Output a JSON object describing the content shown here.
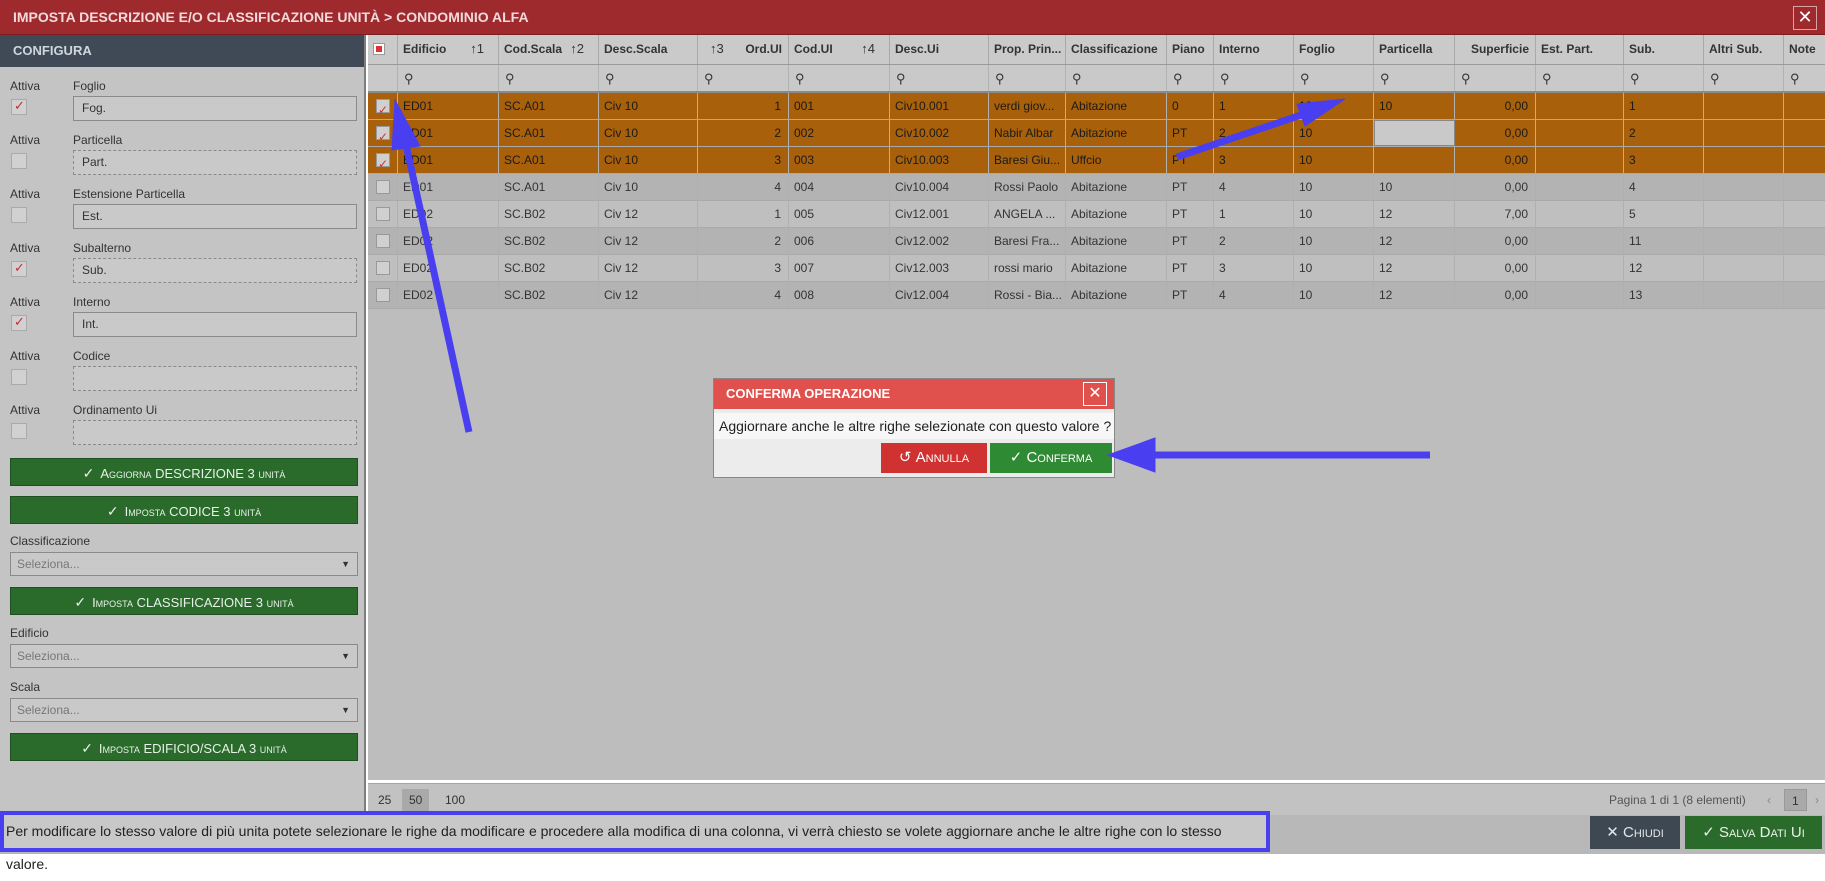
{
  "window": {
    "title": "IMPOSTA DESCRIZIONE E/O CLASSIFICAZIONE UNITÀ > CONDOMINIO ALFA",
    "close": "✕"
  },
  "config": {
    "header": "CONFIGURA",
    "active_label": "Attiva",
    "fields": [
      {
        "label": "Foglio",
        "value": "Fog.",
        "active": true
      },
      {
        "label": "Particella",
        "value": "Part.",
        "active": false
      },
      {
        "label": "Estensione Particella",
        "value": "Est.",
        "active": false
      },
      {
        "label": "Subalterno",
        "value": "Sub.",
        "active": true
      },
      {
        "label": "Interno",
        "value": "Int.",
        "active": true
      },
      {
        "label": "Codice",
        "value": "",
        "active": false
      },
      {
        "label": "Ordinamento Ui",
        "value": "",
        "active": false
      }
    ],
    "btn_descrizione": "Aggiorna DESCRIZIONE 3 unità",
    "btn_codice": "Imposta CODICE 3 unità",
    "classificazione_label": "Classificazione",
    "classificazione_placeholder": "Seleziona...",
    "btn_classificazione": "Imposta CLASSIFICAZIONE 3 unità",
    "edificio_label": "Edificio",
    "edificio_placeholder": "Seleziona...",
    "scala_label": "Scala",
    "scala_placeholder": "Seleziona...",
    "btn_edificio": "Imposta EDIFICIO/SCALA 3 unità"
  },
  "grid": {
    "columns": [
      "Edificio",
      "Cod.Scala",
      "Desc.Scala",
      "Ord.UI",
      "Cod.UI",
      "Desc.Ui",
      "Prop. Prin...",
      "Classificazione",
      "Piano",
      "Interno",
      "Foglio",
      "Particella",
      "Superficie",
      "Est. Part.",
      "Sub.",
      "Altri Sub.",
      "Note"
    ],
    "sort_marks": {
      "edificio": "↑1",
      "codscala": "↑2",
      "ordui": "↑3",
      "codui": "↑4"
    },
    "rows": [
      [
        "ED01",
        "SC.A01",
        "Civ 10",
        "1",
        "001",
        "Civ10.001",
        "verdi giov...",
        "Abitazione",
        "0",
        "1",
        "10",
        "10",
        "0,00",
        "",
        "1",
        "",
        ""
      ],
      [
        "ED01",
        "SC.A01",
        "Civ 10",
        "2",
        "002",
        "Civ10.002",
        "Nabir Albar",
        "Abitazione",
        "PT",
        "2",
        "10",
        "",
        "0,00",
        "",
        "2",
        "",
        ""
      ],
      [
        "ED01",
        "SC.A01",
        "Civ 10",
        "3",
        "003",
        "Civ10.003",
        "Baresi Giu...",
        "Uffcio",
        "PT",
        "3",
        "10",
        "",
        "0,00",
        "",
        "3",
        "",
        ""
      ],
      [
        "ED01",
        "SC.A01",
        "Civ 10",
        "4",
        "004",
        "Civ10.004",
        "Rossi Paolo",
        "Abitazione",
        "PT",
        "4",
        "10",
        "10",
        "0,00",
        "",
        "4",
        "",
        ""
      ],
      [
        "ED02",
        "SC.B02",
        "Civ 12",
        "1",
        "005",
        "Civ12.001",
        "ANGELA ...",
        "Abitazione",
        "PT",
        "1",
        "10",
        "12",
        "7,00",
        "",
        "5",
        "",
        ""
      ],
      [
        "ED02",
        "SC.B02",
        "Civ 12",
        "2",
        "006",
        "Civ12.002",
        "Baresi Fra...",
        "Abitazione",
        "PT",
        "2",
        "10",
        "12",
        "0,00",
        "",
        "11",
        "",
        ""
      ],
      [
        "ED02",
        "SC.B02",
        "Civ 12",
        "3",
        "007",
        "Civ12.003",
        "rossi mario",
        "Abitazione",
        "PT",
        "3",
        "10",
        "12",
        "0,00",
        "",
        "12",
        "",
        ""
      ],
      [
        "ED02",
        "SC.B02",
        "Civ 12",
        "4",
        "008",
        "Civ12.004",
        "Rossi - Bia...",
        "Abitazione",
        "PT",
        "4",
        "10",
        "12",
        "0,00",
        "",
        "13",
        "",
        ""
      ]
    ],
    "selected": [
      true,
      true,
      true,
      false,
      false,
      false,
      false,
      false
    ]
  },
  "pager": {
    "sizes": [
      "25",
      "50",
      "100"
    ],
    "active_size": "50",
    "info": "Pagina 1 di 1 (8 elementi)",
    "page": "1"
  },
  "modal": {
    "title": "CONFERMA OPERAZIONE",
    "message": "Aggiornare anche le altre righe selezionate con questo valore ?",
    "annulla": "Annulla",
    "conferma": "Conferma"
  },
  "footer": {
    "hint": "Per modificare lo stesso valore di più unita potete selezionare le righe da modificare e procedere alla modifica di una colonna, vi verrà chiesto se volete aggiornare anche le altre righe con lo stesso valore.",
    "chiudi": "Chiudi",
    "salva": "Salva Dati Ui"
  },
  "colors": {
    "title_bg": "#9e2a2e",
    "selected_row": "#a8600a",
    "green_button": "#2a6b2c",
    "modal_header": "#e0514d",
    "annotation": "#4a3ff0"
  }
}
